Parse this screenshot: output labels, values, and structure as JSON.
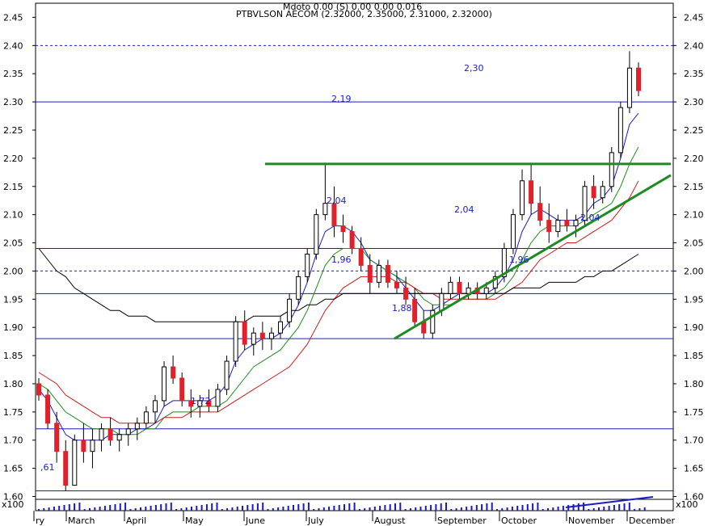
{
  "chart_data": {
    "type": "candlestick",
    "title": "PTBVLSON AECOM (2.32000, 2.35000, 2.31000, 2.32000)",
    "subtitle": "Mdoto 0.00 (S) 0.00 0.00 0.016",
    "y_axis": {
      "ticks": [
        "1.60",
        "1.65",
        "1.70",
        "1.75",
        "1.80",
        "1.85",
        "1.90",
        "1.95",
        "2.00",
        "2.05",
        "2.10",
        "2.15",
        "2.20",
        "2.25",
        "2.30",
        "2.35",
        "2.40",
        "2.45"
      ],
      "ylim": [
        1.595,
        2.475
      ]
    },
    "x_axis": {
      "labels": [
        "ry",
        "March",
        "April",
        "May",
        "June",
        "July",
        "August",
        "September",
        "October",
        "November",
        "December"
      ]
    },
    "volume_label": "x100",
    "horizontal_levels": [
      {
        "value": 2.3,
        "style": "solid",
        "color": "#1a1acc"
      },
      {
        "value": 2.04,
        "style": "solid",
        "color": "#1a1acc"
      },
      {
        "value": 1.96,
        "style": "solid",
        "color": "#1a1acc"
      },
      {
        "value": 1.88,
        "style": "solid",
        "color": "#1a1acc"
      },
      {
        "value": 1.72,
        "style": "solid",
        "color": "#1a1acc"
      },
      {
        "value": 1.61,
        "style": "solid",
        "color": "#1a1acc"
      },
      {
        "value": 2.4,
        "style": "dashed",
        "color": "#1a1acc"
      },
      {
        "value": 2.0,
        "style": "dashed",
        "color": "#1a1acc"
      }
    ],
    "annotations": [
      "2,30",
      "2,19",
      "2,04",
      "2,04",
      "2,04",
      "1,96",
      "1,96",
      "1,88",
      "1,72",
      ",61"
    ],
    "resistance_line": {
      "value": 2.19,
      "color": "#1f8a1f"
    },
    "support_trendline": {
      "from": [
        "August",
        1.88
      ],
      "to": [
        "December",
        2.17
      ],
      "color": "#1f8a1f"
    },
    "candles": [
      [
        1.8,
        1.81,
        1.77,
        1.78
      ],
      [
        1.78,
        1.79,
        1.72,
        1.73
      ],
      [
        1.73,
        1.75,
        1.66,
        1.68
      ],
      [
        1.68,
        1.7,
        1.61,
        1.62
      ],
      [
        1.62,
        1.71,
        1.62,
        1.7
      ],
      [
        1.7,
        1.73,
        1.66,
        1.68
      ],
      [
        1.68,
        1.72,
        1.65,
        1.7
      ],
      [
        1.7,
        1.73,
        1.68,
        1.72
      ],
      [
        1.72,
        1.74,
        1.69,
        1.7
      ],
      [
        1.7,
        1.72,
        1.68,
        1.71
      ],
      [
        1.71,
        1.73,
        1.69,
        1.72
      ],
      [
        1.72,
        1.74,
        1.7,
        1.73
      ],
      [
        1.73,
        1.76,
        1.72,
        1.75
      ],
      [
        1.75,
        1.78,
        1.73,
        1.77
      ],
      [
        1.77,
        1.84,
        1.76,
        1.83
      ],
      [
        1.83,
        1.85,
        1.8,
        1.81
      ],
      [
        1.81,
        1.82,
        1.76,
        1.77
      ],
      [
        1.77,
        1.79,
        1.74,
        1.76
      ],
      [
        1.76,
        1.78,
        1.74,
        1.77
      ],
      [
        1.77,
        1.79,
        1.75,
        1.76
      ],
      [
        1.76,
        1.8,
        1.75,
        1.79
      ],
      [
        1.79,
        1.85,
        1.78,
        1.84
      ],
      [
        1.84,
        1.92,
        1.83,
        1.91
      ],
      [
        1.91,
        1.93,
        1.86,
        1.87
      ],
      [
        1.87,
        1.9,
        1.85,
        1.89
      ],
      [
        1.89,
        1.91,
        1.86,
        1.88
      ],
      [
        1.88,
        1.9,
        1.86,
        1.89
      ],
      [
        1.89,
        1.92,
        1.88,
        1.91
      ],
      [
        1.91,
        1.96,
        1.9,
        1.95
      ],
      [
        1.95,
        2.0,
        1.94,
        1.99
      ],
      [
        1.99,
        2.04,
        1.98,
        2.03
      ],
      [
        2.03,
        2.11,
        2.02,
        2.1
      ],
      [
        2.1,
        2.19,
        2.09,
        2.12
      ],
      [
        2.12,
        2.15,
        2.06,
        2.08
      ],
      [
        2.08,
        2.1,
        2.05,
        2.07
      ],
      [
        2.07,
        2.08,
        2.03,
        2.04
      ],
      [
        2.04,
        2.06,
        2.0,
        2.01
      ],
      [
        2.01,
        2.03,
        1.96,
        1.98
      ],
      [
        1.98,
        2.02,
        1.97,
        2.01
      ],
      [
        2.01,
        2.02,
        1.97,
        1.98
      ],
      [
        1.98,
        2.0,
        1.96,
        1.97
      ],
      [
        1.97,
        1.99,
        1.94,
        1.95
      ],
      [
        1.95,
        1.97,
        1.9,
        1.91
      ],
      [
        1.91,
        1.93,
        1.88,
        1.89
      ],
      [
        1.89,
        1.94,
        1.88,
        1.93
      ],
      [
        1.93,
        1.97,
        1.92,
        1.96
      ],
      [
        1.96,
        1.99,
        1.95,
        1.98
      ],
      [
        1.98,
        1.99,
        1.95,
        1.96
      ],
      [
        1.96,
        1.98,
        1.95,
        1.97
      ],
      [
        1.97,
        1.98,
        1.95,
        1.96
      ],
      [
        1.96,
        1.98,
        1.95,
        1.97
      ],
      [
        1.97,
        2.0,
        1.96,
        1.99
      ],
      [
        1.99,
        2.05,
        1.98,
        2.04
      ],
      [
        2.04,
        2.11,
        2.03,
        2.1
      ],
      [
        2.1,
        2.18,
        2.09,
        2.16
      ],
      [
        2.16,
        2.19,
        2.1,
        2.12
      ],
      [
        2.12,
        2.15,
        2.08,
        2.09
      ],
      [
        2.09,
        2.12,
        2.05,
        2.07
      ],
      [
        2.07,
        2.1,
        2.06,
        2.09
      ],
      [
        2.09,
        2.11,
        2.07,
        2.08
      ],
      [
        2.08,
        2.1,
        2.06,
        2.09
      ],
      [
        2.09,
        2.16,
        2.08,
        2.15
      ],
      [
        2.15,
        2.17,
        2.11,
        2.13
      ],
      [
        2.13,
        2.16,
        2.12,
        2.15
      ],
      [
        2.15,
        2.22,
        2.14,
        2.21
      ],
      [
        2.21,
        2.3,
        2.2,
        2.29
      ],
      [
        2.29,
        2.39,
        2.28,
        2.36
      ],
      [
        2.36,
        2.37,
        2.31,
        2.32
      ]
    ],
    "series": [
      {
        "color": "#1a1acc",
        "values": [
          1.79,
          1.77,
          1.74,
          1.71,
          1.7,
          1.7,
          1.7,
          1.7,
          1.71,
          1.71,
          1.71,
          1.72,
          1.72,
          1.73,
          1.76,
          1.77,
          1.77,
          1.77,
          1.77,
          1.77,
          1.78,
          1.8,
          1.84,
          1.86,
          1.87,
          1.88,
          1.88,
          1.89,
          1.91,
          1.94,
          1.98,
          2.03,
          2.07,
          2.08,
          2.08,
          2.07,
          2.05,
          2.02,
          2.01,
          2.0,
          1.99,
          1.97,
          1.95,
          1.93,
          1.93,
          1.94,
          1.95,
          1.96,
          1.96,
          1.96,
          1.96,
          1.97,
          1.99,
          2.02,
          2.07,
          2.1,
          2.11,
          2.1,
          2.09,
          2.09,
          2.09,
          2.1,
          2.12,
          2.13,
          2.15,
          2.2,
          2.26,
          2.28
        ]
      },
      {
        "color": "#1f8a1f",
        "values": [
          1.8,
          1.79,
          1.77,
          1.75,
          1.74,
          1.73,
          1.72,
          1.72,
          1.72,
          1.71,
          1.71,
          1.71,
          1.72,
          1.72,
          1.74,
          1.75,
          1.75,
          1.75,
          1.76,
          1.76,
          1.76,
          1.77,
          1.79,
          1.81,
          1.83,
          1.84,
          1.85,
          1.86,
          1.88,
          1.9,
          1.93,
          1.97,
          2.01,
          2.03,
          2.04,
          2.04,
          2.04,
          2.02,
          2.01,
          2.0,
          1.99,
          1.98,
          1.97,
          1.95,
          1.94,
          1.94,
          1.94,
          1.95,
          1.95,
          1.95,
          1.95,
          1.96,
          1.97,
          1.99,
          2.02,
          2.05,
          2.07,
          2.08,
          2.08,
          2.08,
          2.08,
          2.09,
          2.1,
          2.11,
          2.12,
          2.15,
          2.19,
          2.22
        ]
      },
      {
        "color": "#cc1a1a",
        "values": [
          1.82,
          1.81,
          1.8,
          1.78,
          1.77,
          1.76,
          1.75,
          1.74,
          1.74,
          1.73,
          1.73,
          1.73,
          1.73,
          1.73,
          1.74,
          1.74,
          1.74,
          1.75,
          1.75,
          1.75,
          1.75,
          1.76,
          1.77,
          1.78,
          1.79,
          1.8,
          1.81,
          1.82,
          1.83,
          1.85,
          1.87,
          1.9,
          1.93,
          1.95,
          1.97,
          1.98,
          1.99,
          1.99,
          1.99,
          1.99,
          1.98,
          1.98,
          1.97,
          1.96,
          1.96,
          1.95,
          1.95,
          1.95,
          1.95,
          1.95,
          1.95,
          1.95,
          1.96,
          1.97,
          1.98,
          2.0,
          2.02,
          2.03,
          2.04,
          2.05,
          2.05,
          2.06,
          2.07,
          2.08,
          2.09,
          2.11,
          2.13,
          2.16
        ]
      },
      {
        "color": "#000000",
        "values": [
          2.04,
          2.02,
          2.0,
          1.99,
          1.97,
          1.96,
          1.95,
          1.94,
          1.93,
          1.93,
          1.92,
          1.92,
          1.92,
          1.91,
          1.91,
          1.91,
          1.91,
          1.91,
          1.91,
          1.91,
          1.91,
          1.91,
          1.91,
          1.91,
          1.92,
          1.92,
          1.92,
          1.92,
          1.93,
          1.93,
          1.94,
          1.94,
          1.95,
          1.95,
          1.96,
          1.96,
          1.96,
          1.96,
          1.96,
          1.96,
          1.96,
          1.96,
          1.96,
          1.96,
          1.96,
          1.96,
          1.96,
          1.96,
          1.96,
          1.96,
          1.96,
          1.96,
          1.96,
          1.97,
          1.97,
          1.97,
          1.97,
          1.98,
          1.98,
          1.98,
          1.98,
          1.99,
          1.99,
          2.0,
          2.0,
          2.01,
          2.02,
          2.03
        ]
      }
    ],
    "grid": false
  }
}
